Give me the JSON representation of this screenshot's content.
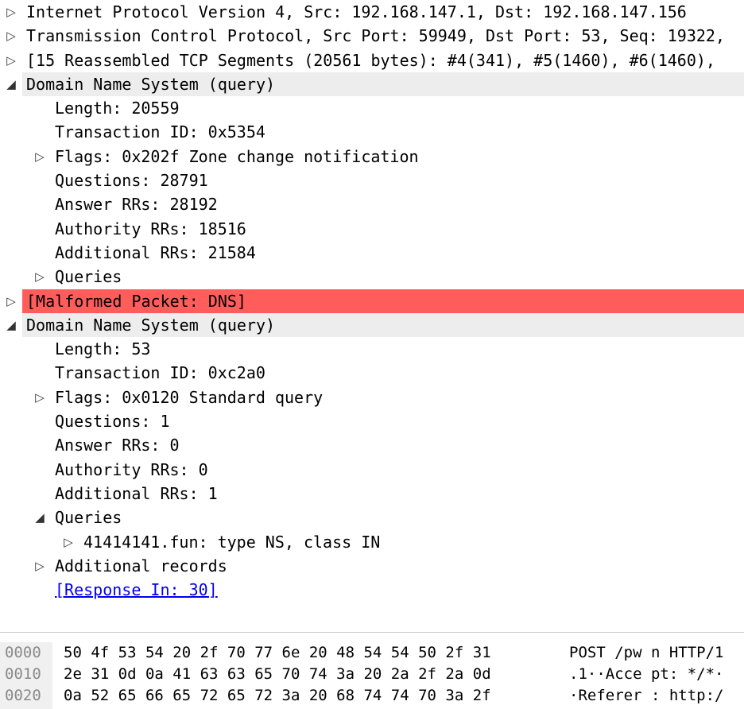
{
  "tree": [
    {
      "indent": 0,
      "toggle": "▷",
      "text": "Internet Protocol Version 4, Src: 192.168.147.1, Dst: 192.168.147.156",
      "hl": ""
    },
    {
      "indent": 0,
      "toggle": "▷",
      "text": "Transmission Control Protocol, Src Port: 59949, Dst Port: 53, Seq: 19322,",
      "hl": ""
    },
    {
      "indent": 0,
      "toggle": "▷",
      "text": "[15 Reassembled TCP Segments (20561 bytes): #4(341), #5(1460), #6(1460),",
      "hl": ""
    },
    {
      "indent": 0,
      "toggle": "◢",
      "text": "Domain Name System (query)",
      "hl": "gray"
    },
    {
      "indent": 1,
      "toggle": "",
      "text": "Length: 20559",
      "hl": ""
    },
    {
      "indent": 1,
      "toggle": "",
      "text": "Transaction ID: 0x5354",
      "hl": ""
    },
    {
      "indent": 1,
      "toggle": "▷",
      "text": "Flags: 0x202f Zone change notification",
      "hl": ""
    },
    {
      "indent": 1,
      "toggle": "",
      "text": "Questions: 28791",
      "hl": ""
    },
    {
      "indent": 1,
      "toggle": "",
      "text": "Answer RRs: 28192",
      "hl": ""
    },
    {
      "indent": 1,
      "toggle": "",
      "text": "Authority RRs: 18516",
      "hl": ""
    },
    {
      "indent": 1,
      "toggle": "",
      "text": "Additional RRs: 21584",
      "hl": ""
    },
    {
      "indent": 1,
      "toggle": "▷",
      "text": "Queries",
      "hl": ""
    },
    {
      "indent": 0,
      "toggle": "▷",
      "text": "[Malformed Packet: DNS]",
      "hl": "red"
    },
    {
      "indent": 0,
      "toggle": "◢",
      "text": "Domain Name System (query)",
      "hl": "gray"
    },
    {
      "indent": 1,
      "toggle": "",
      "text": "Length: 53",
      "hl": ""
    },
    {
      "indent": 1,
      "toggle": "",
      "text": "Transaction ID: 0xc2a0",
      "hl": ""
    },
    {
      "indent": 1,
      "toggle": "▷",
      "text": "Flags: 0x0120 Standard query",
      "hl": ""
    },
    {
      "indent": 1,
      "toggle": "",
      "text": "Questions: 1",
      "hl": ""
    },
    {
      "indent": 1,
      "toggle": "",
      "text": "Answer RRs: 0",
      "hl": ""
    },
    {
      "indent": 1,
      "toggle": "",
      "text": "Authority RRs: 0",
      "hl": ""
    },
    {
      "indent": 1,
      "toggle": "",
      "text": "Additional RRs: 1",
      "hl": ""
    },
    {
      "indent": 1,
      "toggle": "◢",
      "text": "Queries",
      "hl": ""
    },
    {
      "indent": 2,
      "toggle": "▷",
      "text": "41414141.fun: type NS, class IN",
      "hl": ""
    },
    {
      "indent": 1,
      "toggle": "▷",
      "text": "Additional records",
      "hl": ""
    },
    {
      "indent": 1,
      "toggle": "",
      "text": "[Response In: 30]",
      "hl": "",
      "link": true
    }
  ],
  "hex": [
    {
      "offset": "0000",
      "bytes": "50 4f 53 54 20 2f 70 77  6e 20 48 54 54 50 2f 31",
      "ascii": "POST /pw n HTTP/1"
    },
    {
      "offset": "0010",
      "bytes": "2e 31 0d 0a 41 63 63 65  70 74 3a 20 2a 2f 2a 0d",
      "ascii": ".1··Acce pt: */*·"
    },
    {
      "offset": "0020",
      "bytes": "0a 52 65 66 65 72 65 72  3a 20 68 74 74 70 3a 2f",
      "ascii": "·Referer : http:/"
    }
  ],
  "colors": {
    "malformed_bg": "#ff5c5c",
    "section_bg": "#ededed",
    "link": "#0000ee"
  }
}
